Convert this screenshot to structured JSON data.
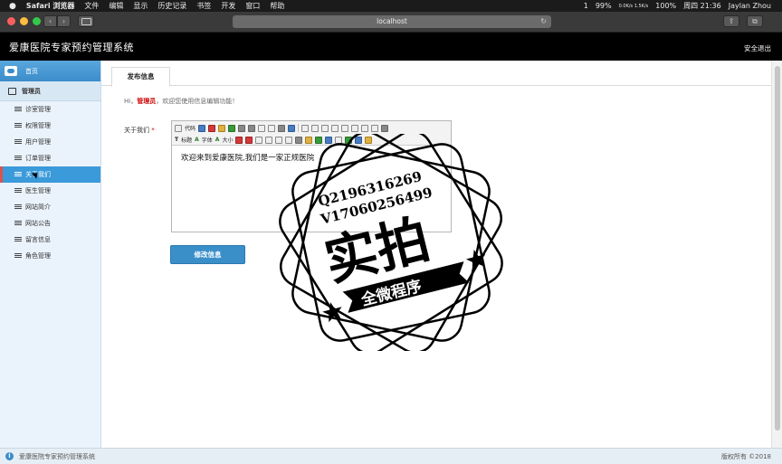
{
  "menubar": {
    "app_name": "Safari 浏览器",
    "items": [
      "文件",
      "编辑",
      "显示",
      "历史记录",
      "书签",
      "开发",
      "窗口",
      "帮助"
    ],
    "status_left": "99%",
    "net_speed": "0.0K/s 1.5K/s",
    "battery": "100%",
    "datetime": "周四 21:36",
    "user": "Jaylan Zhou",
    "notification_count": "1"
  },
  "browser": {
    "url": "localhost",
    "back_icon": "chevron-left-icon",
    "forward_icon": "chevron-right-icon",
    "reload_glyph": "↻",
    "share_glyph": "⇪",
    "tabs_glyph": "⧉"
  },
  "header": {
    "title": "爱康医院专家预约管理系统",
    "logout": "安全退出"
  },
  "sidebar": {
    "home": "首页",
    "group": "管理员",
    "items": [
      {
        "label": "诊室管理"
      },
      {
        "label": "权限管理"
      },
      {
        "label": "用户管理"
      },
      {
        "label": "订单管理"
      },
      {
        "label": "关于我们",
        "active": true
      },
      {
        "label": "医生管理"
      },
      {
        "label": "网站简介"
      },
      {
        "label": "网站公告"
      },
      {
        "label": "留言信息"
      },
      {
        "label": "角色管理"
      }
    ]
  },
  "main": {
    "tab": "发布信息",
    "greeting_prefix": "Hi，",
    "greeting_role": "管理员",
    "greeting_suffix": "，欢迎您使用信息编辑功能！",
    "field_label": "关于我们",
    "required_mark": "*",
    "editor": {
      "toolbar_row1": [
        "代码"
      ],
      "toolbar_row2": [
        "标题",
        "字体",
        "大小"
      ],
      "content": "欢迎来到爱康医院,我们是一家正规医院"
    },
    "submit": "修改信息"
  },
  "footer": {
    "left": "爱康医院专家预约管理系统",
    "right": "版权所有 ©2018"
  },
  "watermark": {
    "line1": "Q2196316269",
    "line2": "V17060256499",
    "big_text": "实拍",
    "banner": "全微程序"
  },
  "colors": {
    "accent": "#3b8cca",
    "active_item": "#3b9ad9",
    "header_bg": "#000000",
    "role_red": "#cc0000"
  }
}
